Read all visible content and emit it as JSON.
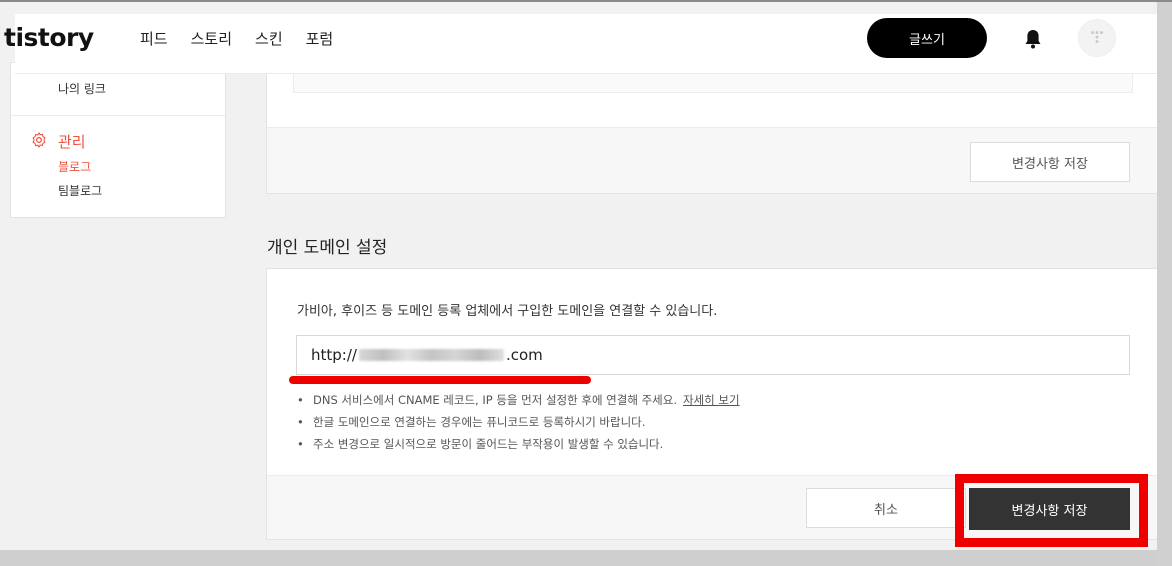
{
  "header": {
    "logo": "tistory",
    "nav": [
      "피드",
      "스토리",
      "스킨",
      "포럼"
    ],
    "write_button": "글쓰기"
  },
  "sidebar": {
    "my_links": "나의 링크",
    "manage_title": "관리",
    "blog": "블로그",
    "team_blog": "팀블로그"
  },
  "upper_card": {
    "save_button": "변경사항 저장"
  },
  "domain_section": {
    "title": "개인 도메인 설정",
    "description": "가비아, 후이즈 등 도메인 등록 업체에서 구입한 도메인을 연결할 수 있습니다.",
    "input_prefix": "http://",
    "input_suffix": ".com",
    "notes": [
      "DNS 서비스에서 CNAME 레코드, IP 등을 먼저 설정한 후에 연결해 주세요.",
      "한글 도메인으로 연결하는 경우에는 퓨니코드로 등록하시기 바랍니다.",
      "주소 변경으로 일시적으로 방문이 줄어드는 부작용이 발생할 수 있습니다."
    ],
    "more_link": "자세히 보기",
    "cancel_button": "취소",
    "save_button": "변경사항 저장"
  },
  "colors": {
    "accent": "#f0503c",
    "annotation": "#ee0000",
    "dark_button": "#333333"
  },
  "icons": [
    "bell-icon",
    "gear-icon",
    "avatar-icon"
  ]
}
